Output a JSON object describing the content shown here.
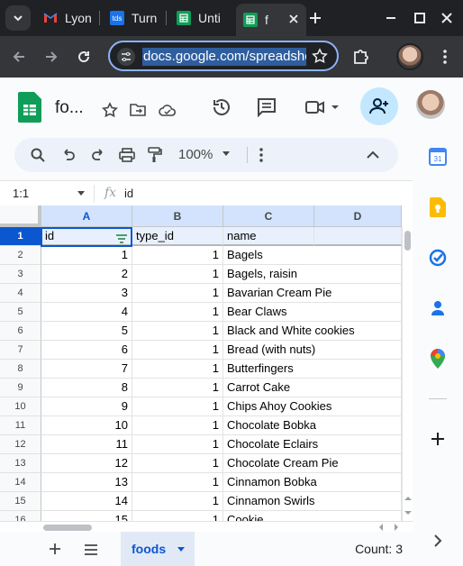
{
  "browser": {
    "tabs": [
      {
        "label": "Lyon",
        "icon": "gmail-icon"
      },
      {
        "label": "Turn",
        "icon": "tds-icon",
        "favicon_text": "tds"
      },
      {
        "label": "Unti",
        "icon": "sheets-icon"
      },
      {
        "label": "f",
        "icon": "sheets-icon"
      }
    ],
    "url": "docs.google.com/spreadshee"
  },
  "doc": {
    "title": "fo..."
  },
  "toolbar": {
    "zoom": "100%"
  },
  "formula_bar": {
    "cell_ref": "1:1",
    "fx": "fx",
    "value": "id"
  },
  "grid": {
    "columns": [
      "A",
      "B",
      "C",
      "D"
    ],
    "row_numbers": [
      "1",
      "2",
      "3",
      "4",
      "5",
      "6",
      "7",
      "8",
      "9",
      "10",
      "11",
      "12",
      "13",
      "14",
      "15",
      "16"
    ],
    "header": [
      "id",
      "type_id",
      "name"
    ],
    "rows": [
      {
        "id": "1",
        "type_id": "1",
        "name": "Bagels"
      },
      {
        "id": "2",
        "type_id": "1",
        "name": "Bagels, raisin"
      },
      {
        "id": "3",
        "type_id": "1",
        "name": "Bavarian Cream Pie"
      },
      {
        "id": "4",
        "type_id": "1",
        "name": "Bear Claws"
      },
      {
        "id": "5",
        "type_id": "1",
        "name": "Black and White cookies"
      },
      {
        "id": "6",
        "type_id": "1",
        "name": "Bread (with nuts)"
      },
      {
        "id": "7",
        "type_id": "1",
        "name": "Butterfingers"
      },
      {
        "id": "8",
        "type_id": "1",
        "name": "Carrot Cake"
      },
      {
        "id": "9",
        "type_id": "1",
        "name": "Chips Ahoy Cookies"
      },
      {
        "id": "10",
        "type_id": "1",
        "name": "Chocolate Bobka"
      },
      {
        "id": "11",
        "type_id": "1",
        "name": "Chocolate Eclairs"
      },
      {
        "id": "12",
        "type_id": "1",
        "name": "Chocolate Cream Pie"
      },
      {
        "id": "13",
        "type_id": "1",
        "name": "Cinnamon Bobka"
      },
      {
        "id": "14",
        "type_id": "1",
        "name": "Cinnamon Swirls"
      },
      {
        "id": "15",
        "type_id": "1",
        "name": "Cookie"
      }
    ]
  },
  "sheets": {
    "active": "foods",
    "status": "Count: 3"
  },
  "colors": {
    "accent": "#0b57d0",
    "share_bg": "#c2e7ff",
    "selected_col": "#d3e3fd",
    "sheet_tab_bg": "#e1e9f7"
  }
}
